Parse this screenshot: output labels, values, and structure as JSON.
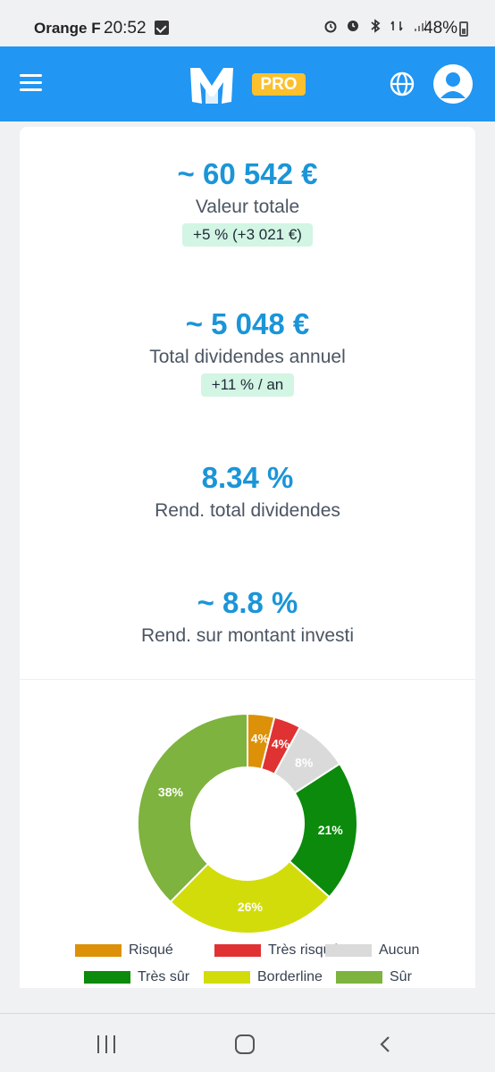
{
  "status_bar": {
    "carrier": "Orange F",
    "time": "20:52",
    "battery": "48%"
  },
  "header": {
    "badge": "PRO",
    "icons": [
      "menu-icon",
      "m-logo-icon",
      "globe-icon",
      "user-avatar-icon"
    ]
  },
  "stats": [
    {
      "value": "~ 60 542 €",
      "label": "Valeur totale",
      "badge": "+5 % (+3 021 €)"
    },
    {
      "value": "~ 5 048 €",
      "label": "Total dividendes annuel",
      "badge": "+11 % / an"
    },
    {
      "value": "8.34 %",
      "label": "Rend. total dividendes"
    },
    {
      "value": "~ 8.8 %",
      "label": "Rend. sur montant investi"
    }
  ],
  "chart_data": {
    "type": "pie",
    "donut": true,
    "legend_position": "bottom",
    "categories": [
      "Risqué",
      "Très risqué",
      "Aucun",
      "Très sûr",
      "Borderline",
      "Sûr"
    ],
    "values": [
      4,
      4,
      8,
      21,
      26,
      38
    ],
    "labels": [
      "4%",
      "4%",
      "8%",
      "21%",
      "26%",
      "38%"
    ],
    "colors": [
      "#dc9108",
      "#e03232",
      "#dadada",
      "#0b8a0b",
      "#d3dc0b",
      "#7db33e"
    ]
  },
  "colors": {
    "header": "#2196f3",
    "accent": "#1b95d8",
    "badge_bg": "#d3f5e4",
    "pro": "#fbc02d"
  }
}
